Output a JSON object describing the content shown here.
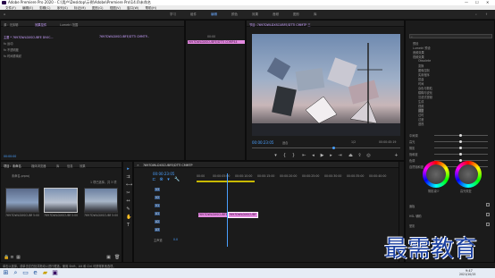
{
  "titlebar": {
    "title": "Adobe Premiere Pro 2020 - C:\\用户\\Desktop\\示例\\Adobe\\Premiere Pro\\14.0\\未命名",
    "controls": [
      "—",
      "☐",
      "✕"
    ]
  },
  "menu": [
    "文件(F)",
    "编辑(E)",
    "剪辑(C)",
    "序列(S)",
    "标记(M)",
    "图形(G)",
    "视图(V)",
    "窗口(W)",
    "帮助(H)"
  ],
  "workspaces": [
    "学习",
    "组件",
    "编辑",
    "颜色",
    "效果",
    "音频",
    "图形",
    "库"
  ],
  "workspace_active": "编辑",
  "source_panel": {
    "tabs": [
      "源：无剪辑",
      "效果控件",
      "Lumetri 范围"
    ],
    "active_tab": "效果控件",
    "clip": "主要 * 7697DWLDXSCUBFE DIVIC...",
    "seq": "7697DWLDXSCUBFE/DTTI CMMTP...",
    "items": [
      "fx 运动",
      "fx 不透明度",
      "fx 时间重映射"
    ],
    "timecode": "00:00:00"
  },
  "mini_timeline": {
    "label": "7697DWLDXSCUBFE/DTTI COMP44",
    "ruler": "00:00"
  },
  "program": {
    "title": "节目: 7697DWLDXSCUBFE/DTTI CMMTP 三",
    "timecode": "00:00:23:05",
    "fit": "适合",
    "quality": "1/2",
    "duration": "00:00:45:19"
  },
  "project": {
    "tabs": [
      "项目：未命名",
      "媒体浏览器",
      "库",
      "信息",
      "效果"
    ],
    "active_tab": "项目：未命名",
    "file": "未命名.prproj",
    "count": "1 项已选择，共 3 项",
    "thumbs": [
      {
        "name": "7697DWLDXSCUBFE.jpg",
        "dur": "5:00"
      },
      {
        "name": "7697DWLDXSCUBF",
        "dur": "5:00"
      },
      {
        "name": "7697DWLDXSCUBF",
        "dur": "5:00"
      }
    ]
  },
  "timeline": {
    "title": "7697DWLDXSCUBFE/DTTI CMMTP",
    "timecode": "00:00:23:05",
    "ruler": [
      "00:00",
      "00:00:05:00",
      "00:00:10:00",
      "00:00:15:00",
      "00:00:20:00",
      "00:00:25:00",
      "00:00:30:00",
      "00:00:35:00",
      "00:00:40:00"
    ],
    "tracks": [
      "V3",
      "V2",
      "V1",
      "A1",
      "A2",
      "A3"
    ],
    "master": "主声道",
    "master_val": "0.0",
    "clips": [
      "7697DWLDXSCUBFE",
      "7697DWLDXSCUBF"
    ]
  },
  "effects": {
    "search": "",
    "tree": [
      "预设",
      "Lumetri 预设",
      "音频效果",
      "视频效果",
      "Obsolete",
      "变换",
      "图像控制",
      "实用程序",
      "扭曲",
      "时间",
      "杂色与颗粒",
      "模糊与锐化",
      "沉浸式视频",
      "生成",
      "视频",
      "调整",
      "过时",
      "过渡",
      "透视",
      "通道",
      "键控",
      "颜色校正",
      "风格化"
    ],
    "sliders": [
      "中间调",
      "高光",
      "阴影",
      "饱和度",
      "色调",
      "自然饱和度"
    ],
    "wheel_labels": [
      "阴影减少",
      "高光恢复"
    ],
    "bottom": [
      "面板",
      "HSL 辅助",
      "晕影"
    ]
  },
  "status": "单击以选择，或单击空白处并拖动以进行框选。使用 Shift、Alt 和 Ctrl 可获得其他选项。",
  "clock": {
    "time": "9:47",
    "date": "2021/10/15"
  },
  "watermark": "最需教育",
  "accent": "#2d8ceb",
  "clip_color": "#e48ae0"
}
